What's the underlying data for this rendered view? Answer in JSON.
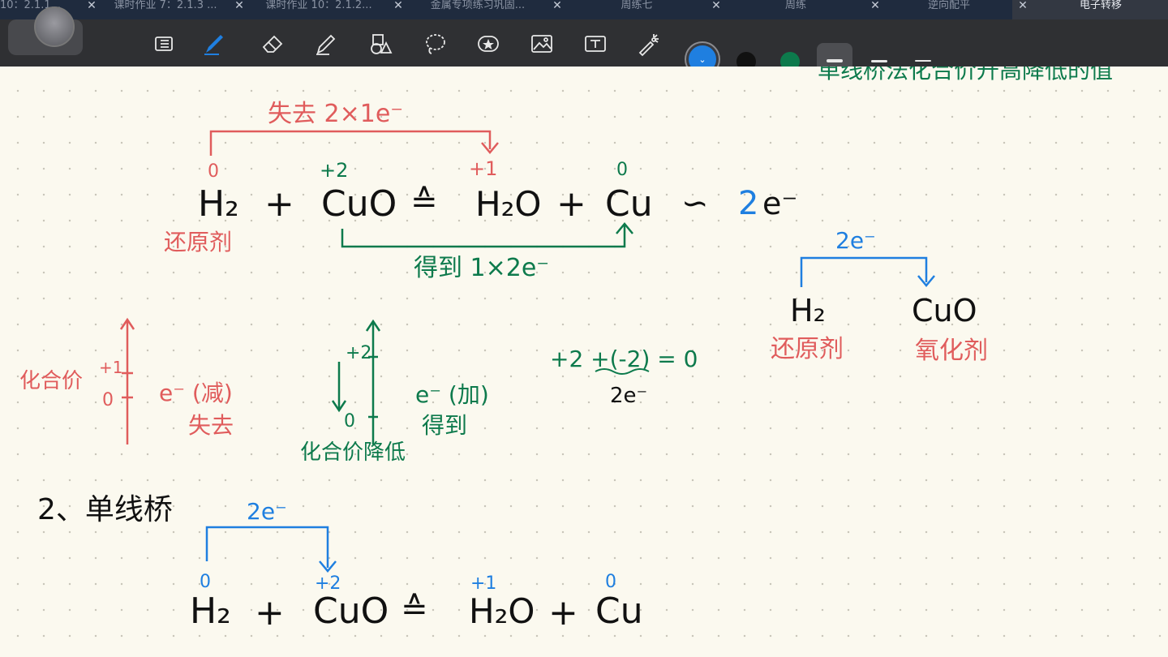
{
  "colors": {
    "red": "#e05c5c",
    "green": "#0d7a4c",
    "blue": "#1f7fe0",
    "black": "#111111",
    "tabbar": "#1f2b3e",
    "toolbar": "#2f3033",
    "paper": "#fbf9ef"
  },
  "tabs": [
    {
      "label": "10：2.1.1..."
    },
    {
      "label": "课时作业 7：2.1.3 ..."
    },
    {
      "label": "课时作业 10：2.1.2..."
    },
    {
      "label": "金属专项练习巩固..."
    },
    {
      "label": "周练七"
    },
    {
      "label": "周练"
    },
    {
      "label": "逆向配平"
    },
    {
      "label": "电子转移",
      "active": true
    }
  ],
  "toolbar": {
    "tools": [
      "page-layout-icon",
      "pen-icon",
      "eraser-icon",
      "highlighter-icon",
      "shapes-icon",
      "lasso-icon",
      "sticker-icon",
      "image-icon",
      "text-icon",
      "laser-pointer-icon"
    ],
    "swatches": [
      "#1f7fe0",
      "#111111",
      "#0d7a4c"
    ]
  },
  "notes": {
    "top_right": "单线桥法化合价升高降低的值",
    "eq1": {
      "lost": "失去 2×1e⁻",
      "ox_h2": "0",
      "ox_cuo": "+2",
      "ox_h2o": "+1",
      "ox_cu": "0",
      "h2": "H₂",
      "plus1": "+",
      "cuo": "CuO",
      "arrow": "≙",
      "h2o": "H₂O",
      "plus2": "+",
      "cu": "Cu",
      "tilde": "∽",
      "two": "2",
      "e": "e⁻",
      "reducer": "还原剂",
      "gained": "得到 1×2e⁻"
    },
    "right_diagram": {
      "e": "2e⁻",
      "h2": "H₂",
      "cuo": "CuO",
      "reducer": "还原剂",
      "oxidizer": "氧化剂"
    },
    "left_axis": {
      "label": "化合价",
      "plus1": "+1",
      "zero": "0",
      "e": "e⁻ (减)",
      "lost": "失去"
    },
    "mid_axis": {
      "plus2": "+2",
      "zero": "0",
      "e": "e⁻ (加)",
      "gained": "得到",
      "lower": "化合价降低"
    },
    "calc": {
      "line1": "+2  +(-2)  = 0",
      "line2": "2e⁻"
    },
    "section2": {
      "title": "2、单线桥",
      "e": "2e⁻",
      "ox_h2": "0",
      "ox_cuo": "+2",
      "ox_h2o": "+1",
      "ox_cu": "0",
      "h2": "H₂",
      "plus1": "+",
      "cuo": "CuO",
      "arrow": "≙",
      "h2o": "H₂O",
      "plus2": "+",
      "cu": "Cu"
    }
  }
}
